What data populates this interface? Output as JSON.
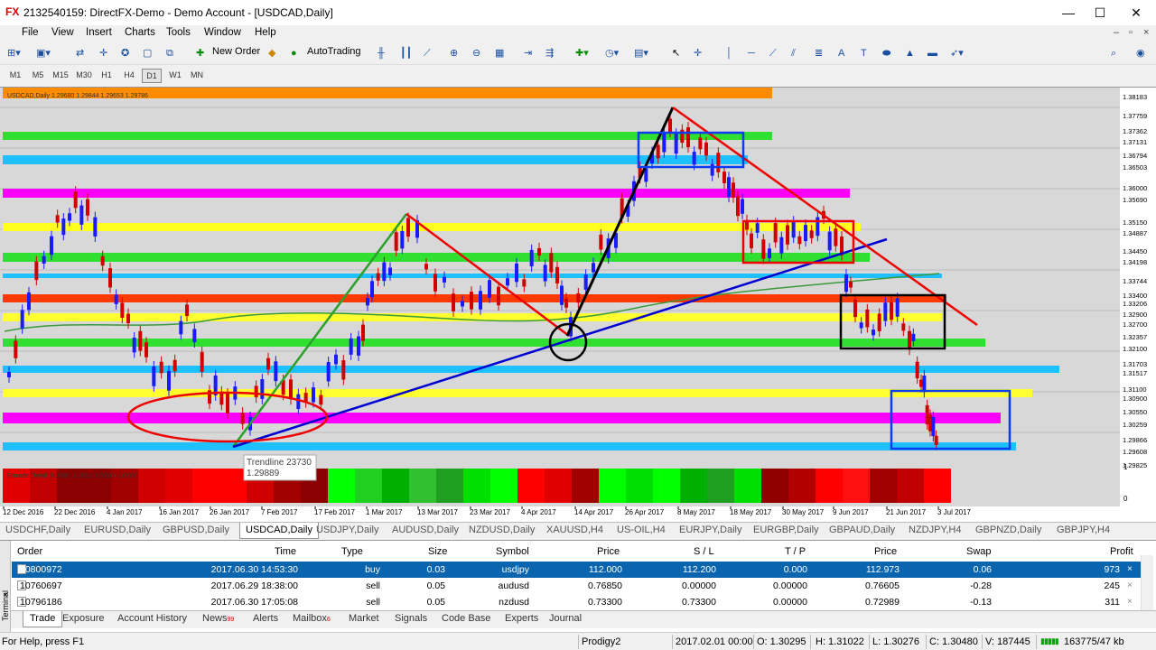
{
  "window": {
    "title": "2132540159: DirectFX-Demo - Demo Account - [USDCAD,Daily]",
    "app_icon": "FX",
    "minimize": "—",
    "maximize": "☐",
    "close": "✕"
  },
  "menu": [
    "File",
    "View",
    "Insert",
    "Charts",
    "Tools",
    "Window",
    "Help"
  ],
  "toolbar": {
    "new_order": "New Order",
    "autotrading": "AutoTrading"
  },
  "timeframes": [
    "M1",
    "M5",
    "M15",
    "M30",
    "H1",
    "H4",
    "D1",
    "W1",
    "MN"
  ],
  "active_timeframe": "D1",
  "chart": {
    "info": "USDCAD,Daily  1.29680 1.29844 1.29653 1.29786",
    "indicator_label": "Fxtrade Trend: 0.0000 -1.0000 0.0000 -1.0000",
    "tooltip_title": "Trendline 23730",
    "tooltip_value": "1.29889",
    "price_labels": [
      "1.38183",
      "1.37759",
      "1.37362",
      "1.37131",
      "1.36794",
      "1.36503",
      "1.36000",
      "1.35690",
      "1.35150",
      "1.34887",
      "1.34450",
      "1.34198",
      "1.33744",
      "1.33400",
      "1.33206",
      "1.32900",
      "1.32700",
      "1.32357",
      "1.32100",
      "1.31703",
      "1.31517",
      "1.31100",
      "1.30900",
      "1.30550",
      "1.30259",
      "1.29866",
      "1.29608",
      "1.29825"
    ],
    "indicator_scale": [
      "1",
      "0"
    ],
    "date_labels": [
      "12 Dec 2016",
      "22 Dec 2016",
      "4 Jan 2017",
      "16 Jan 2017",
      "26 Jan 2017",
      "7 Feb 2017",
      "17 Feb 2017",
      "1 Mar 2017",
      "13 Mar 2017",
      "23 Mar 2017",
      "4 Apr 2017",
      "14 Apr 2017",
      "26 Apr 2017",
      "8 May 2017",
      "18 May 2017",
      "30 May 2017",
      "9 Jun 2017",
      "21 Jun 2017",
      "3 Jul 2017"
    ]
  },
  "chart_tabs": [
    "USDCHF,Daily",
    "EURUSD,Daily",
    "GBPUSD,Daily",
    "USDCAD,Daily",
    "USDJPY,Daily",
    "AUDUSD,Daily",
    "NZDUSD,Daily",
    "XAUUSD,H4",
    "US-OIL,H4",
    "EURJPY,Daily",
    "EURGBP,Daily",
    "GBPAUD,Daily",
    "NZDJPY,H4",
    "GBPNZD,Daily",
    "GBPJPY,H4"
  ],
  "active_chart_tab": "USDCAD,Daily",
  "terminal": {
    "side_label": "Terminal",
    "close": "×",
    "headers": {
      "order": "Order",
      "time": "Time",
      "type": "Type",
      "size": "Size",
      "symbol": "Symbol",
      "price": "Price",
      "sl": "S / L",
      "tp": "T / P",
      "price2": "Price",
      "swap": "Swap",
      "profit": "Profit"
    },
    "orders": [
      {
        "order": "10800972",
        "time": "2017.06.30 14:53:30",
        "type": "buy",
        "size": "0.03",
        "symbol": "usdjpy",
        "price": "112.000",
        "sl": "112.200",
        "tp": "0.000",
        "cur": "112.973",
        "swap": "0.06",
        "profit": "973"
      },
      {
        "order": "10760697",
        "time": "2017.06.29 18:38:00",
        "type": "sell",
        "size": "0.05",
        "symbol": "audusd",
        "price": "0.76850",
        "sl": "0.00000",
        "tp": "0.00000",
        "cur": "0.76605",
        "swap": "-0.28",
        "profit": "245"
      },
      {
        "order": "10796186",
        "time": "2017.06.30 17:05:08",
        "type": "sell",
        "size": "0.05",
        "symbol": "nzdusd",
        "price": "0.73300",
        "sl": "0.73300",
        "tp": "0.00000",
        "cur": "0.72989",
        "swap": "-0.13",
        "profit": "311"
      }
    ],
    "tabs": [
      "Trade",
      "Exposure",
      "Account History",
      "News",
      "Alerts",
      "Mailbox",
      "Market",
      "Signals",
      "Code Base",
      "Experts",
      "Journal"
    ],
    "news_badge": "99",
    "mailbox_badge": "6"
  },
  "status": {
    "help": "For Help, press F1",
    "profile": "Prodigy2",
    "datetime": "2017.02.01 00:00",
    "open": "O: 1.30295",
    "high": "H: 1.31022",
    "low": "L: 1.30276",
    "close": "C: 1.30480",
    "volume": "V: 187445",
    "traffic": "163775/47 kb"
  }
}
